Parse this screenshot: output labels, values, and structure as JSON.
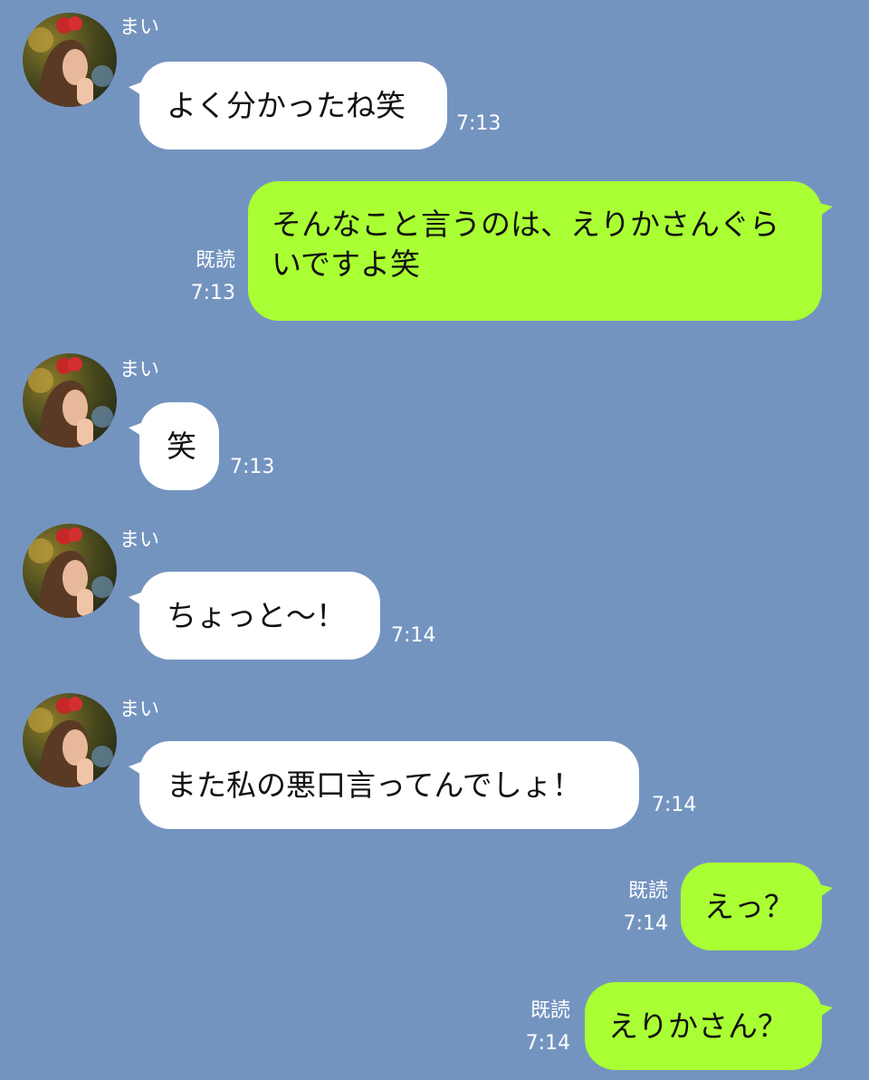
{
  "colors": {
    "background": "#7494c0",
    "incoming_bubble": "#ffffff",
    "outgoing_bubble": "#a9ff33",
    "meta_text": "#ffffff"
  },
  "messages": [
    {
      "direction": "in",
      "sender": "まい",
      "text": "よく分かったね笑",
      "time": "7:13"
    },
    {
      "direction": "out",
      "read": "既読",
      "text": "そんなこと言うのは、えりかさんぐらいですよ笑",
      "time": "7:13"
    },
    {
      "direction": "in",
      "sender": "まい",
      "text": "笑",
      "time": "7:13"
    },
    {
      "direction": "in",
      "sender": "まい",
      "text": "ちょっと〜！",
      "time": "7:14"
    },
    {
      "direction": "in",
      "sender": "まい",
      "text": "また私の悪口言ってんでしょ！",
      "time": "7:14"
    },
    {
      "direction": "out",
      "read": "既読",
      "text": "えっ？",
      "time": "7:14"
    },
    {
      "direction": "out",
      "read": "既読",
      "text": "えりかさん？",
      "time": "7:14"
    }
  ]
}
